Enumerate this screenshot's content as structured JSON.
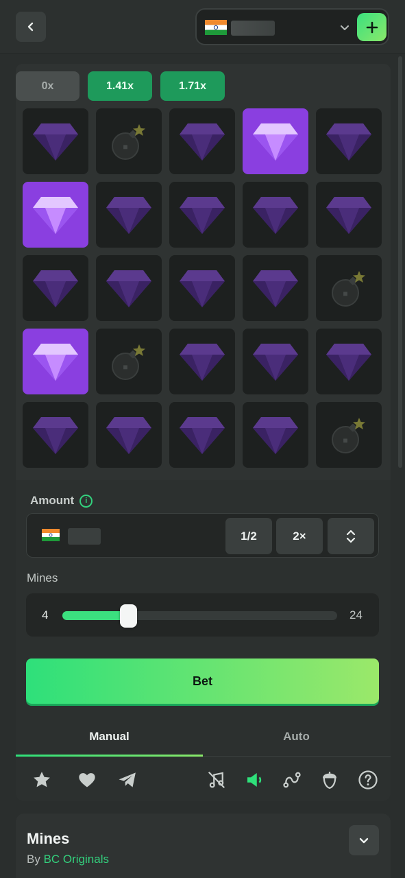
{
  "header": {
    "back_icon": "chevron-left-icon",
    "wallet_icon": "india-flag-icon",
    "dropdown_icon": "chevron-down-icon",
    "deposit_icon": "plus-icon"
  },
  "multipliers": [
    "0x",
    "1.41x",
    "1.71x"
  ],
  "board": {
    "rows": [
      [
        "gem",
        "mine",
        "gem",
        "gem-revealed",
        "gem"
      ],
      [
        "gem-revealed",
        "gem",
        "gem",
        "gem",
        "gem"
      ],
      [
        "gem",
        "gem",
        "gem",
        "gem",
        "mine"
      ],
      [
        "gem-revealed",
        "mine",
        "gem",
        "gem",
        "gem"
      ],
      [
        "gem",
        "gem",
        "gem",
        "gem",
        "mine"
      ]
    ],
    "colors": {
      "gem": "#4a2d7a",
      "revealed": "#8a3fe0",
      "tile": "#1d201f"
    }
  },
  "amount": {
    "label": "Amount",
    "half_label": "1/2",
    "double_label": "2×"
  },
  "mines": {
    "label": "Mines",
    "value": "4",
    "max": "24",
    "min_count": 1,
    "count": 4,
    "max_count": 24
  },
  "bet": {
    "label": "Bet"
  },
  "tabs": [
    {
      "label": "Manual",
      "active": true
    },
    {
      "label": "Auto",
      "active": false
    }
  ],
  "toolbar_icons": [
    "star-icon",
    "heart-icon",
    "telegram-icon",
    "music-off-icon",
    "sound-on-icon",
    "route-icon",
    "acorn-icon",
    "help-icon"
  ],
  "info": {
    "title": "Mines",
    "by_prefix": "By",
    "by_link": "BC Originals"
  },
  "accent_color": "#2ee07a"
}
